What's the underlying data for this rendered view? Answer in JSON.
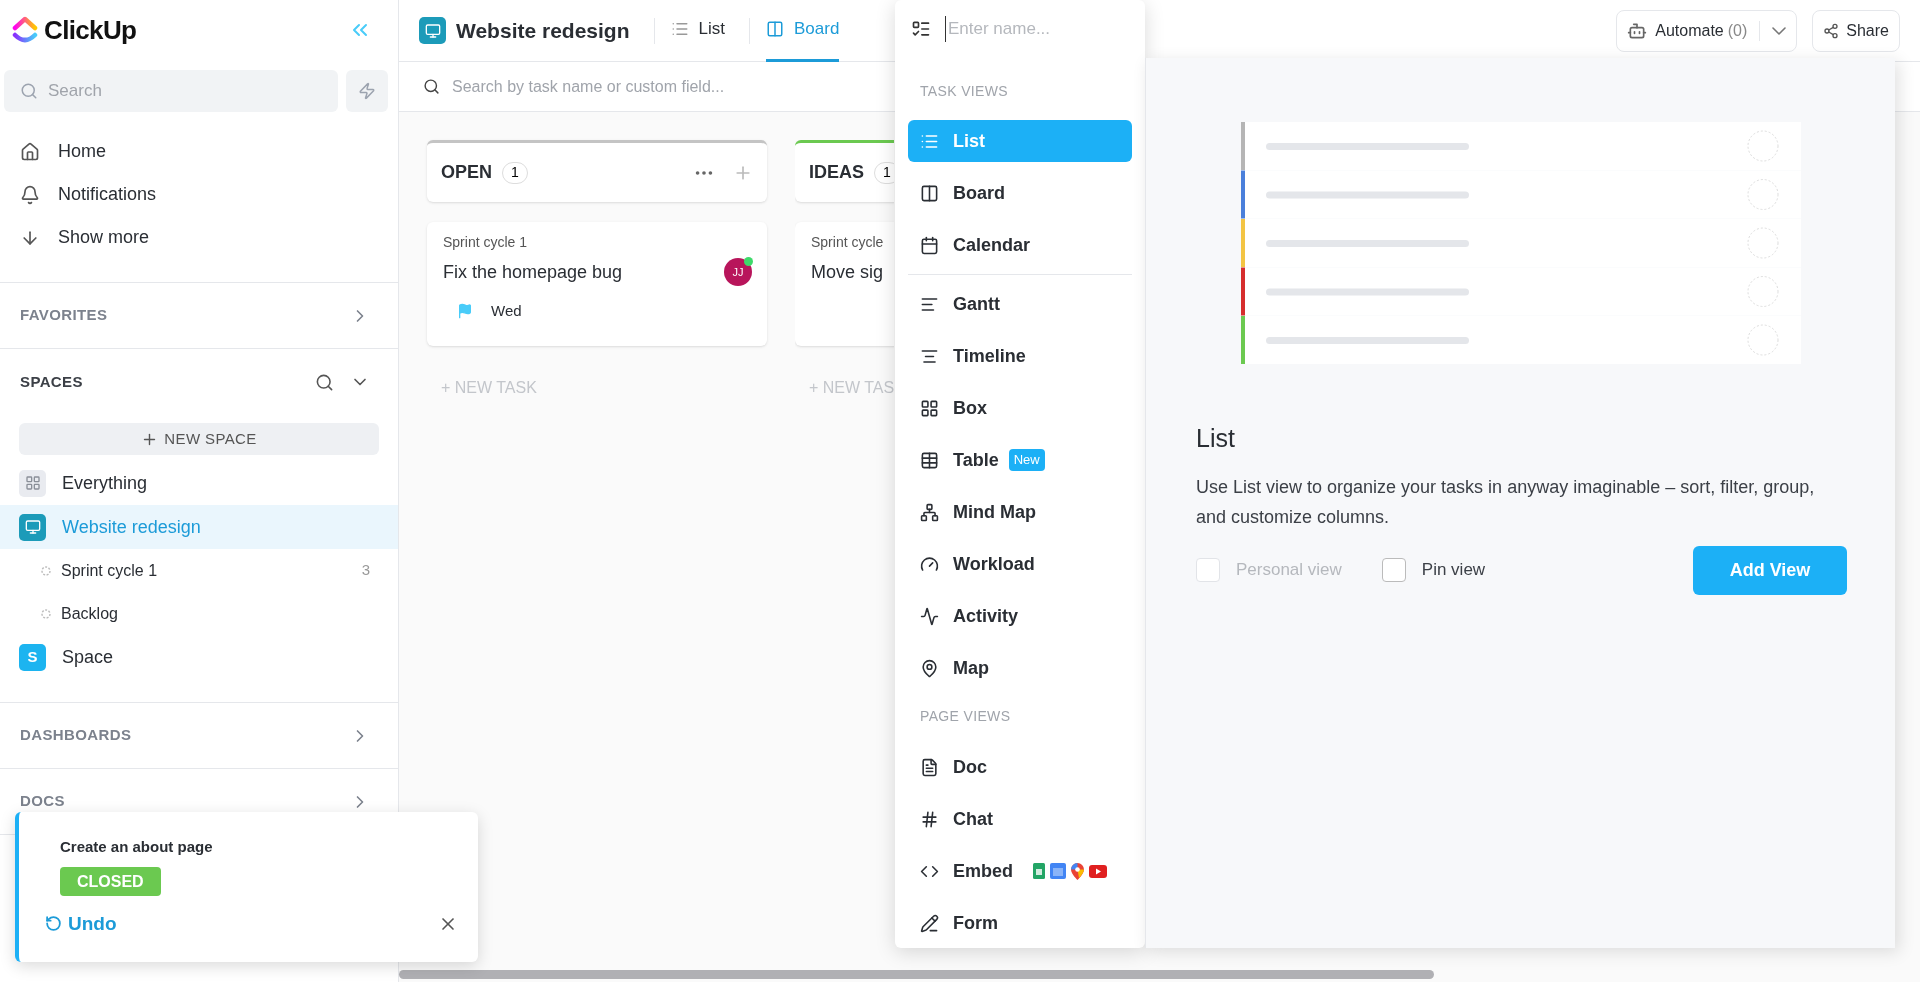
{
  "sidebar": {
    "logo": "ClickUp",
    "search": {
      "placeholder": "Search"
    },
    "nav": [
      {
        "kind": "home",
        "label": "Home"
      },
      {
        "kind": "notifications",
        "label": "Notifications"
      },
      {
        "kind": "more",
        "label": "Show more"
      }
    ],
    "favorites": {
      "title": "FAVORITES"
    },
    "spaces": {
      "title": "SPACES",
      "new_space": "NEW SPACE",
      "items": [
        {
          "kind": "everything",
          "label": "Everything",
          "selected": false,
          "color": "#e9ebf0"
        },
        {
          "kind": "space",
          "label": "Website redesign",
          "selected": true,
          "color": "#1c9bb9",
          "children": [
            {
              "label": "Sprint cycle 1",
              "count": "3",
              "selected": false
            },
            {
              "label": "Backlog",
              "selected": false
            }
          ]
        },
        {
          "kind": "letter",
          "label": "Space",
          "initial": "S",
          "selected": false,
          "color": "#1cb4f0"
        }
      ]
    },
    "dashboards": {
      "title": "DASHBOARDS"
    },
    "docs": {
      "title": "DOCS"
    }
  },
  "header": {
    "title": "Website redesign",
    "tabs": [
      {
        "label": "List",
        "selected": false
      },
      {
        "label": "Board",
        "selected": true
      }
    ],
    "automate": "Automate",
    "automate_count": "(0)",
    "share": "Share"
  },
  "board": {
    "search": {
      "placeholder": "Search by task name or custom field..."
    },
    "columns": [
      {
        "name": "OPEN",
        "count": "1",
        "color": "#c4c4c4",
        "tasks": [
          {
            "list": "Sprint cycle 1",
            "title": "Fix the homepage bug",
            "due": "Wed",
            "assignee": "JJ"
          }
        ],
        "new_task": "+ NEW TASK"
      },
      {
        "name": "IDEAS",
        "count": "1",
        "color": "#6bc950",
        "tasks": [
          {
            "list": "Sprint cycle",
            "title": "Move sig"
          }
        ],
        "new_task": "+ NEW TAS"
      }
    ]
  },
  "view_menu": {
    "name_placeholder": "Enter name...",
    "groups": [
      {
        "title": "TASK VIEWS",
        "items": [
          {
            "label": "List",
            "selected": true
          },
          {
            "label": "Board",
            "selected": false
          },
          {
            "label": "Calendar",
            "selected": false
          },
          {
            "label": "Gantt",
            "selected": false,
            "divider_before": true
          },
          {
            "label": "Timeline",
            "selected": false
          },
          {
            "label": "Box",
            "selected": false
          },
          {
            "label": "Table",
            "selected": false,
            "badge": "New"
          },
          {
            "label": "Mind Map",
            "selected": false
          },
          {
            "label": "Workload",
            "selected": false
          },
          {
            "label": "Activity",
            "selected": false
          },
          {
            "label": "Map",
            "selected": false
          }
        ]
      },
      {
        "title": "PAGE VIEWS",
        "items": [
          {
            "label": "Doc",
            "selected": false
          },
          {
            "label": "Chat",
            "selected": false
          },
          {
            "label": "Embed",
            "selected": false,
            "apps": true
          },
          {
            "label": "Form",
            "selected": false
          }
        ]
      }
    ],
    "preview": {
      "title": "List",
      "description": "Use List view to organize your tasks in anyway imaginable – sort, filter, group, and customize columns.",
      "options": [
        {
          "label": "Personal view",
          "checked": false,
          "disabled": true
        },
        {
          "label": "Pin view",
          "checked": false,
          "disabled": false
        }
      ],
      "button": "Add View"
    }
  },
  "toast": {
    "title": "Create an about page",
    "status": "CLOSED",
    "undo": "Undo"
  }
}
